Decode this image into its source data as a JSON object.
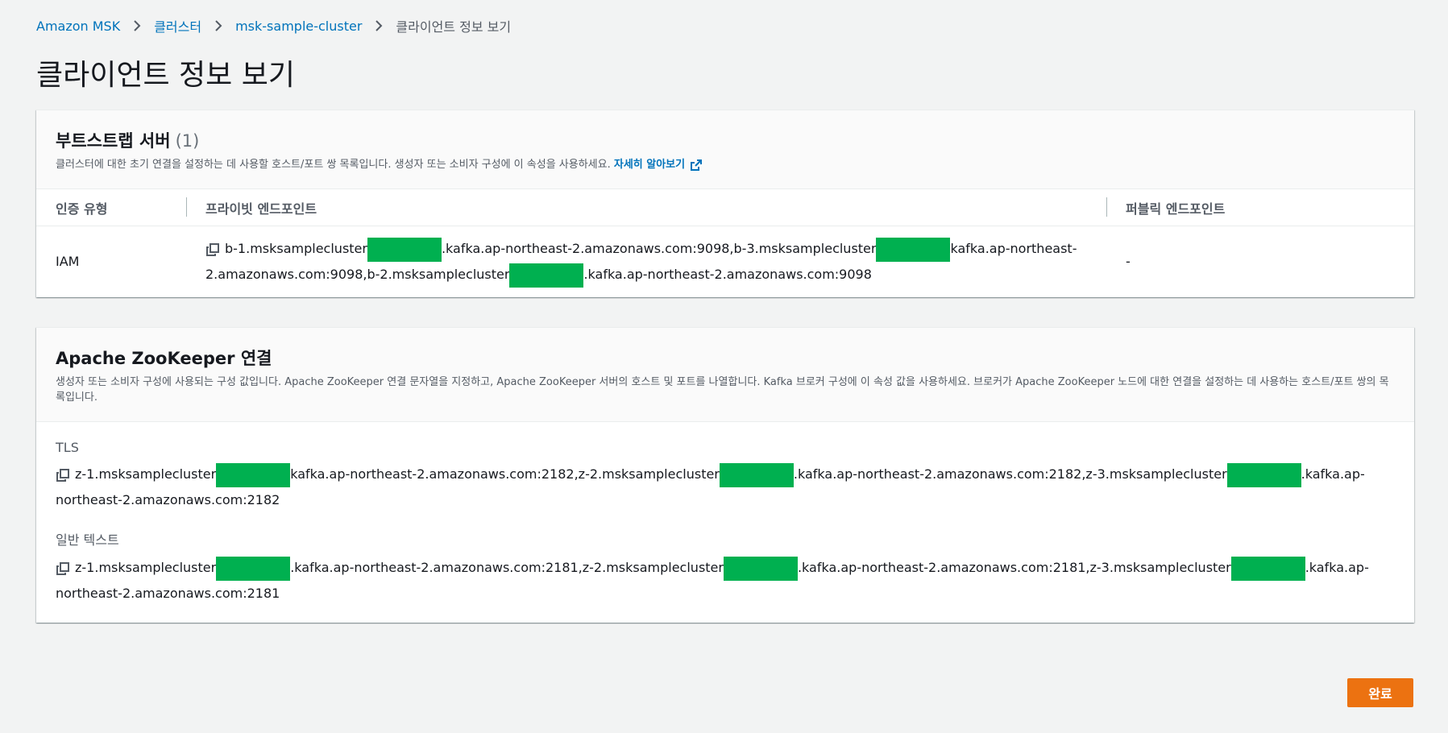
{
  "breadcrumb": {
    "items": [
      "Amazon MSK",
      "클러스터",
      "msk-sample-cluster"
    ],
    "current": "클라이언트 정보 보기"
  },
  "page": {
    "title": "클라이언트 정보 보기"
  },
  "bootstrap": {
    "title": "부트스트랩 서버",
    "count": "(1)",
    "description": "클러스터에 대한 초기 연결을 설정하는 데 사용할 호스트/포트 쌍 목록입니다. 생성자 또는 소비자 구성에 이 속성을 사용하세요. ",
    "learn_more": "자세히 알아보기",
    "columns": [
      "인증 유형",
      "프라이빗 엔드포인트",
      "퍼블릭 엔드포인트"
    ],
    "rows": [
      {
        "auth": "IAM",
        "private_parts": [
          "b-1.msksamplecluster",
          ".kafka.ap-northeast-2.amazonaws.com:9098,b-3.msksamplecluster",
          "kafka.ap-northeast-2.amazonaws.com:9098,b-2.msksamplecluster",
          ".kafka.ap-northeast-2.amazonaws.com:9098"
        ],
        "public": "-"
      }
    ]
  },
  "zookeeper": {
    "title": "Apache ZooKeeper 연결",
    "description": "생성자 또는 소비자 구성에 사용되는 구성 값입니다. Apache ZooKeeper 연결 문자열을 지정하고, Apache ZooKeeper 서버의 호스트 및 포트를 나열합니다. Kafka 브로커 구성에 이 속성 값을 사용하세요. 브로커가 Apache ZooKeeper 노드에 대한 연결을 설정하는 데 사용하는 호스트/포트 쌍의 목록입니다.",
    "tls": {
      "label": "TLS",
      "parts": [
        "z-1.msksamplecluster",
        "kafka.ap-northeast-2.amazonaws.com:2182,z-2.msksamplecluster",
        ".kafka.ap-northeast-2.amazonaws.com:2182,z-3.msksamplecluster",
        ".kafka.ap-northeast-2.amazonaws.com:2182"
      ]
    },
    "plaintext": {
      "label": "일반 텍스트",
      "parts": [
        "z-1.msksamplecluster",
        ".kafka.ap-northeast-2.amazonaws.com:2181,z-2.msksamplecluster",
        ".kafka.ap-northeast-2.amazonaws.com:2181,z-3.msksamplecluster",
        ".kafka.ap-northeast-2.amazonaws.com:2181"
      ]
    }
  },
  "actions": {
    "done": "완료"
  },
  "icons": {
    "breadcrumb_separator": "chevron-right-icon",
    "copy": "copy-icon",
    "external": "external-link-icon"
  },
  "colors": {
    "link": "#0073bb",
    "primary_button": "#ec7211",
    "redaction": "#00b050",
    "background": "#f2f3f3"
  }
}
